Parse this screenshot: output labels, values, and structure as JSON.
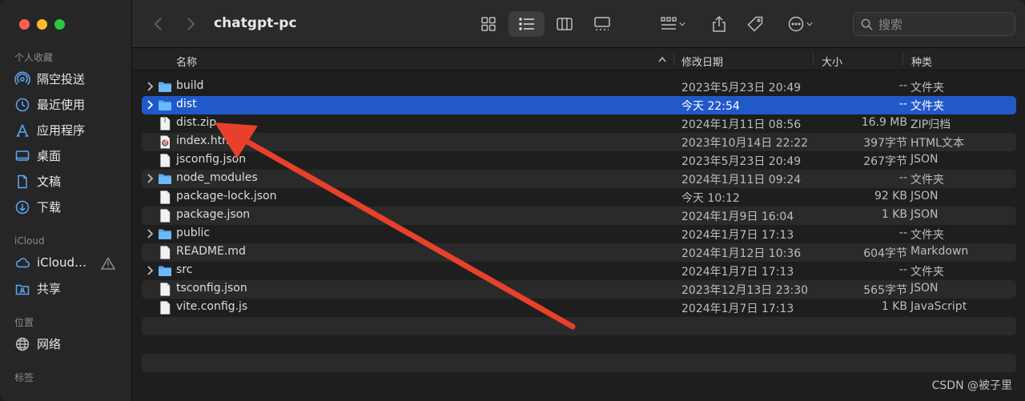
{
  "window": {
    "title": "chatgpt-pc"
  },
  "sidebar": {
    "sections": [
      {
        "label": "个人收藏",
        "items": [
          {
            "label": "隔空投送",
            "icon": "airdrop-icon"
          },
          {
            "label": "最近使用",
            "icon": "clock-icon"
          },
          {
            "label": "应用程序",
            "icon": "applications-icon"
          },
          {
            "label": "桌面",
            "icon": "desktop-icon"
          },
          {
            "label": "文稿",
            "icon": "document-icon"
          },
          {
            "label": "下载",
            "icon": "download-icon"
          }
        ]
      },
      {
        "label": "iCloud",
        "items": [
          {
            "label": "iCloud…",
            "icon": "cloud-icon"
          },
          {
            "label": "共享",
            "icon": "shared-folder-icon"
          }
        ]
      },
      {
        "label": "位置",
        "items": [
          {
            "label": "网络",
            "icon": "globe-icon"
          }
        ]
      },
      {
        "label": "标签",
        "items": []
      }
    ]
  },
  "toolbar": {
    "search_placeholder": "搜索",
    "icons": [
      "back-icon",
      "forward-icon",
      "icon-view-icon",
      "list-view-icon",
      "column-view-icon",
      "gallery-view-icon",
      "group-icon",
      "share-icon",
      "tag-icon",
      "more-icon"
    ]
  },
  "columns": {
    "name": "名称",
    "date": "修改日期",
    "size": "大小",
    "kind": "种类"
  },
  "files": [
    {
      "name": "build",
      "date": "2023年5月23日 20:49",
      "size": "--",
      "kind": "文件夹",
      "type": "folder"
    },
    {
      "name": "dist",
      "date": "今天 22:54",
      "size": "--",
      "kind": "文件夹",
      "type": "folder",
      "selected": true
    },
    {
      "name": "dist.zip",
      "date": "2024年1月11日 08:56",
      "size": "16.9 MB",
      "kind": "ZIP归档",
      "type": "zip"
    },
    {
      "name": "index.html",
      "date": "2023年10月14日 22:22",
      "size": "397字节",
      "kind": "HTML文本",
      "type": "html"
    },
    {
      "name": "jsconfig.json",
      "date": "2023年5月23日 20:49",
      "size": "267字节",
      "kind": "JSON",
      "type": "file"
    },
    {
      "name": "node_modules",
      "date": "2024年1月11日 09:24",
      "size": "--",
      "kind": "文件夹",
      "type": "folder"
    },
    {
      "name": "package-lock.json",
      "date": "今天 10:12",
      "size": "92 KB",
      "kind": "JSON",
      "type": "file"
    },
    {
      "name": "package.json",
      "date": "2024年1月9日 16:04",
      "size": "1 KB",
      "kind": "JSON",
      "type": "file"
    },
    {
      "name": "public",
      "date": "2024年1月7日 17:13",
      "size": "--",
      "kind": "文件夹",
      "type": "folder"
    },
    {
      "name": "README.md",
      "date": "2024年1月12日 10:36",
      "size": "604字节",
      "kind": "Markdown",
      "type": "file"
    },
    {
      "name": "src",
      "date": "2024年1月7日 17:13",
      "size": "--",
      "kind": "文件夹",
      "type": "folder"
    },
    {
      "name": "tsconfig.json",
      "date": "2023年12月13日 23:30",
      "size": "565字节",
      "kind": "JSON",
      "type": "file"
    },
    {
      "name": "vite.config.js",
      "date": "2024年1月7日 17:13",
      "size": "1 KB",
      "kind": "JavaScript",
      "type": "file"
    }
  ],
  "colors": {
    "selection": "#2159c9",
    "folder": "#5aa9f5",
    "annotation_arrow": "#e8402b"
  },
  "watermark": "CSDN @被子里"
}
